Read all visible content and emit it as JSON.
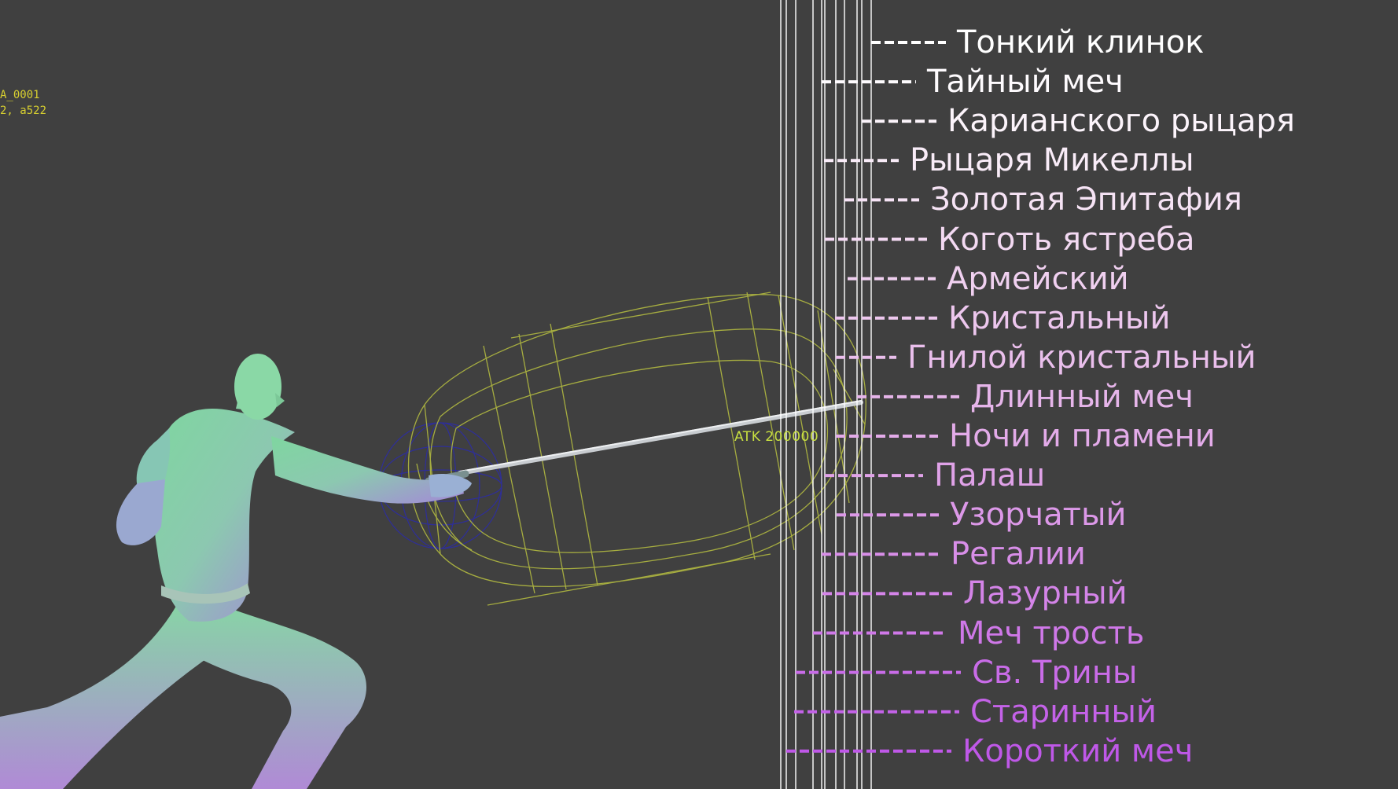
{
  "debug": {
    "line1": "A_0001",
    "line2": "2, a522"
  },
  "hitbox": {
    "label": "ATK 200000"
  },
  "weapons": [
    {
      "name": "Тонкий клинок",
      "color": "#ffffff"
    },
    {
      "name": "Тайный меч",
      "color": "#fefbfe"
    },
    {
      "name": "Карианского рыцаря",
      "color": "#fcf4fb"
    },
    {
      "name": "Рыцаря Микеллы",
      "color": "#f9ecf8"
    },
    {
      "name": "Золотая Эпитафия",
      "color": "#f6e3f5"
    },
    {
      "name": "Коготь ястреба",
      "color": "#f3d9f2"
    },
    {
      "name": "Армейский",
      "color": "#f0d0f0"
    },
    {
      "name": "Кристальный",
      "color": "#edc7ee"
    },
    {
      "name": "Гнилой кристальный",
      "color": "#eabfec"
    },
    {
      "name": "Длинный меч",
      "color": "#e6b5ea"
    },
    {
      "name": "Ночи и пламени",
      "color": "#e3abe9"
    },
    {
      "name": "Палаш",
      "color": "#e0a2e8"
    },
    {
      "name": "Узорчатый",
      "color": "#dc98e8"
    },
    {
      "name": "Регалии",
      "color": "#d88ee8"
    },
    {
      "name": "Лазурный",
      "color": "#d484e8"
    },
    {
      "name": "Меч трость",
      "color": "#cf78e8"
    },
    {
      "name": "Св. Трины",
      "color": "#c96ce8"
    },
    {
      "name": "Старинный",
      "color": "#c462e8"
    },
    {
      "name": "Короткий меч",
      "color": "#bf58e8"
    }
  ]
}
